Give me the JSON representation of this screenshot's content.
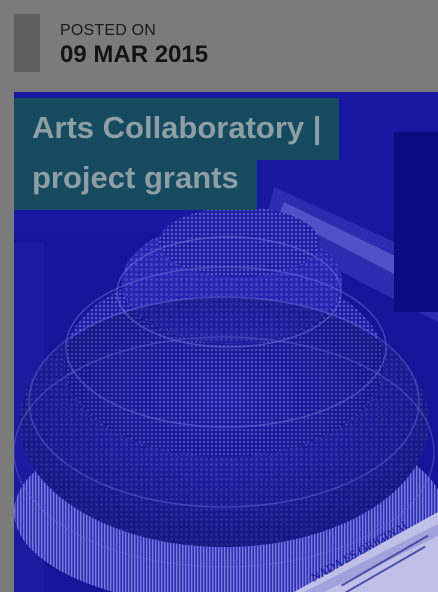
{
  "post": {
    "posted_label": "POSTED ON",
    "posted_date": "09 MAR 2015",
    "title_line1": "Arts Collaboratory |",
    "title_line2": "project grants",
    "image_caption_text": "NADA ES ORIGINAL"
  },
  "colors": {
    "page_background": "#7b7b7b",
    "date_bar": "#5e5e5e",
    "title_background": "#164a5e",
    "title_text": "#8d9ea4",
    "image_tint": "#14149a"
  }
}
